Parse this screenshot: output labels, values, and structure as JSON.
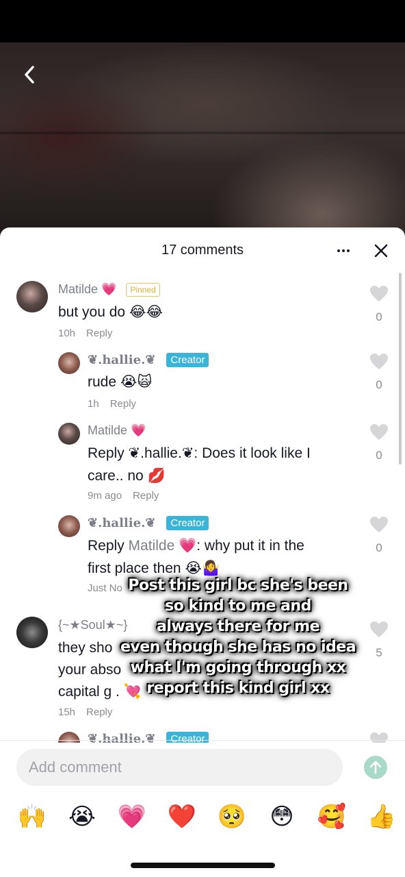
{
  "header": {
    "title": "17 comments"
  },
  "comments": [
    {
      "name": "Matilde 💗",
      "badge": "Pinned",
      "text": "but you do 😂😂",
      "time": "10h",
      "reply": "Reply",
      "likes": "0"
    },
    {
      "name": "❦.hallie.❦",
      "badge": "Creator",
      "text": "rude 😭🙀",
      "time": "1h",
      "reply": "Reply",
      "likes": "0"
    },
    {
      "name": "Matilde 💗",
      "text_line1": "Reply ❦.hallie.❦: Does it look like I",
      "text_line2": "care.. no 💋",
      "time": "9m ago",
      "reply": "Reply",
      "likes": "0"
    },
    {
      "name": "❦.hallie.❦",
      "badge": "Creator",
      "reply_prefix": "Reply",
      "reply_target": "Matilde 💗",
      "text_line1_rest": ": why put it in the",
      "text_line2": "first place then 😭🤷‍♀️",
      "time": "Just No",
      "likes": "0"
    },
    {
      "name": "{~★Soul★~}",
      "text_line1": "they sho",
      "text_line2": "your abso",
      "text_line3": "capital g . 💘",
      "time": "15h",
      "reply": "Reply",
      "likes": "5"
    },
    {
      "name": "❦.hallie.❦",
      "badge": "Creator"
    }
  ],
  "overlay": {
    "line1": "Post this girl bc she's been",
    "line2": "so kind to me and",
    "line3": "always there for me",
    "line4": "even though she has no idea",
    "line5": "what I'm going through xx",
    "line6": "report this kind girl xx"
  },
  "footer": {
    "placeholder": "Add comment",
    "emojis": [
      "🙌",
      "😭",
      "💗",
      "❤️",
      "🥺",
      "😳",
      "🥰",
      "👍"
    ]
  },
  "colors": {
    "creator": "#3ab4d8",
    "pinned": "#e2b12b",
    "send": "#a8d9c9"
  },
  "icons": {
    "back": "chevron-left-icon",
    "more": "more-icon",
    "close": "close-icon",
    "like": "heart-icon",
    "send": "arrow-up-icon"
  }
}
